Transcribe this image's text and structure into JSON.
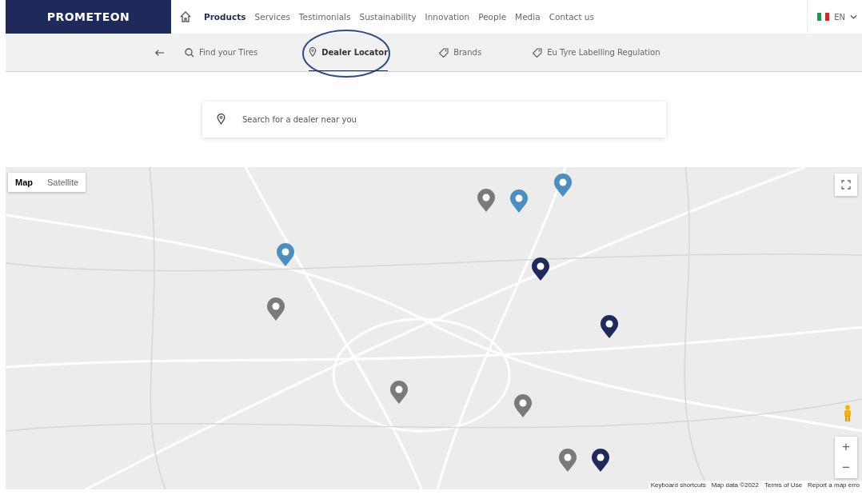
{
  "header": {
    "logo": "PROMETEON",
    "nav": [
      {
        "label": "Products",
        "selected": true
      },
      {
        "label": "Services",
        "selected": false
      },
      {
        "label": "Testimonials",
        "selected": false
      },
      {
        "label": "Sustainability",
        "selected": false
      },
      {
        "label": "Innovation",
        "selected": false
      },
      {
        "label": "People",
        "selected": false
      },
      {
        "label": "Media",
        "selected": false
      },
      {
        "label": "Contact us",
        "selected": false
      }
    ],
    "language": "EN"
  },
  "subnav": [
    {
      "label": "Find your Tires",
      "kind": "search",
      "selected": false
    },
    {
      "label": "Dealer Locator",
      "kind": "pin",
      "selected": true
    },
    {
      "label": "Brands",
      "kind": "tag",
      "selected": false
    },
    {
      "label": "Eu Tyre Labelling Regulation",
      "kind": "tag",
      "selected": false
    }
  ],
  "search": {
    "placeholder": "Search for a dealer near you"
  },
  "map": {
    "types": [
      {
        "label": "Map",
        "selected": true
      },
      {
        "label": "Satellite",
        "selected": false
      }
    ],
    "pins": [
      {
        "color": "#4a8fbf"
      },
      {
        "color": "#7a7a7a"
      },
      {
        "color": "#7a7a7a"
      },
      {
        "color": "#4a8fbf"
      },
      {
        "color": "#4a8fbf"
      },
      {
        "color": "#1f2a5c"
      },
      {
        "color": "#1f2a5c"
      },
      {
        "color": "#7a7a7a"
      },
      {
        "color": "#7a7a7a"
      },
      {
        "color": "#7a7a7a"
      },
      {
        "color": "#1f2a5c"
      }
    ],
    "zoom_in": "+",
    "zoom_out": "−",
    "footer": [
      "Keyboard shortcuts",
      "Map data ©2022",
      "Terms of Use",
      "Report a map erro"
    ]
  }
}
